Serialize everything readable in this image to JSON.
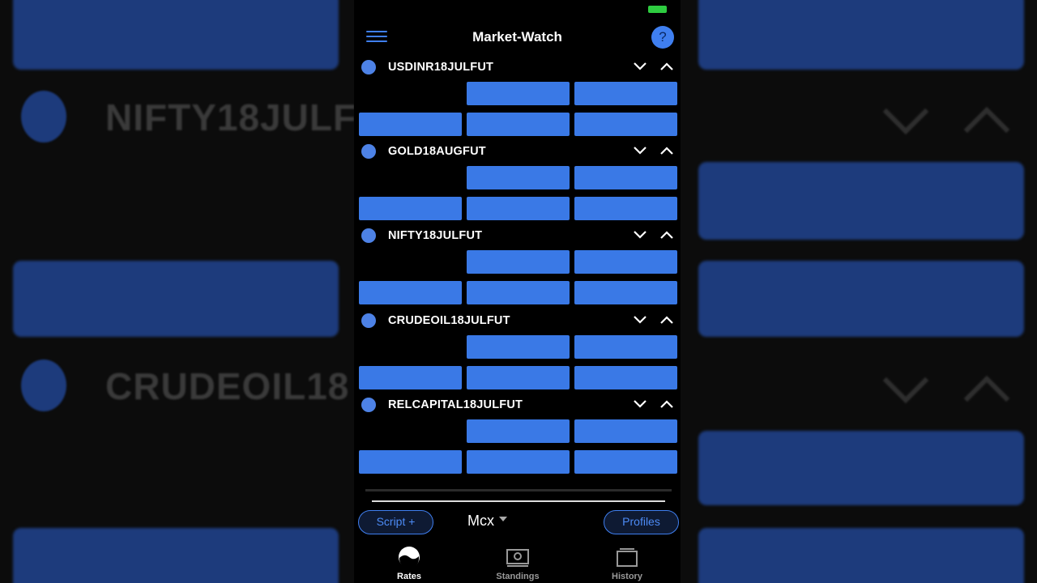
{
  "background": {
    "left_symbols": [
      "NIFTY18JULF",
      "CRUDEOIL18"
    ]
  },
  "header": {
    "title": "Market-Watch",
    "help_label": "?"
  },
  "rows": [
    {
      "symbol": "USDINR18JULFUT"
    },
    {
      "symbol": "GOLD18AUGFUT"
    },
    {
      "symbol": "NIFTY18JULFUT"
    },
    {
      "symbol": "CRUDEOIL18JULFUT"
    },
    {
      "symbol": "RELCAPITAL18JULFUT"
    }
  ],
  "controls": {
    "script_label": "Script +",
    "exchange": "Mcx",
    "profiles_label": "Profiles"
  },
  "tabs": [
    {
      "label": "Rates",
      "icon": "rates-icon",
      "active": true
    },
    {
      "label": "Standings",
      "icon": "standings-icon",
      "active": false
    },
    {
      "label": "History",
      "icon": "history-icon",
      "active": false
    }
  ],
  "colors": {
    "accent": "#3a79e6",
    "status_battery": "#2ecc40",
    "background": "#000000"
  }
}
